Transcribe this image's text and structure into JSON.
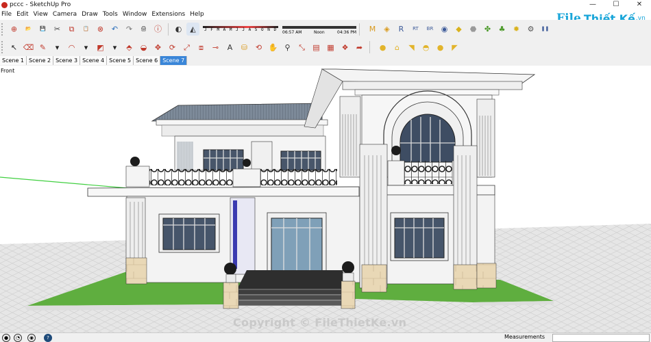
{
  "window": {
    "title": "pccc - SketchUp Pro",
    "min": "—",
    "max": "☐",
    "close": "✕"
  },
  "menu": [
    "File",
    "Edit",
    "View",
    "Camera",
    "Draw",
    "Tools",
    "Window",
    "Extensions",
    "Help"
  ],
  "toolbar_top": [
    {
      "name": "get-started-icon",
      "glyph": "⊕",
      "color": "#c0392b"
    },
    {
      "name": "open-icon",
      "glyph": "📂",
      "color": "#d59b2b"
    },
    {
      "name": "save-icon",
      "glyph": "💾",
      "color": "#3465a4"
    },
    {
      "name": "cut-icon",
      "glyph": "✂",
      "color": "#444"
    },
    {
      "name": "copy-icon",
      "glyph": "⧉",
      "color": "#c0392b"
    },
    {
      "name": "paste-icon",
      "glyph": "📋",
      "color": "#666"
    },
    {
      "name": "erase-icon",
      "glyph": "⊗",
      "color": "#c0392b"
    },
    {
      "name": "undo-icon",
      "glyph": "↶",
      "color": "#2a6ebb"
    },
    {
      "name": "redo-icon",
      "glyph": "↷",
      "color": "#777"
    },
    {
      "name": "print-icon",
      "glyph": "🖨",
      "color": "#333"
    },
    {
      "name": "model-info-icon",
      "glyph": "ⓘ",
      "color": "#c0392b"
    }
  ],
  "shadow": {
    "months": "J F M A M J J A S O N D",
    "time_start": "06:57 AM",
    "time_mid": "Noon",
    "time_end": "04:36 PM"
  },
  "toolbar_top_right": [
    {
      "name": "m-icon",
      "glyph": "M",
      "color": "#d99a1e"
    },
    {
      "name": "tag-icon",
      "glyph": "◈",
      "color": "#d99a1e"
    },
    {
      "name": "r-icon",
      "glyph": "R",
      "color": "#3b5998"
    },
    {
      "name": "rt-icon",
      "glyph": "RT",
      "color": "#3b5998"
    },
    {
      "name": "br-icon",
      "glyph": "BR",
      "color": "#3b5998"
    },
    {
      "name": "orbit-ext-icon",
      "glyph": "◉",
      "color": "#3b5998"
    },
    {
      "name": "tag2-icon",
      "glyph": "◆",
      "color": "#d9b21e"
    },
    {
      "name": "shape-icon",
      "glyph": "⬣",
      "color": "#999"
    },
    {
      "name": "plant-icon",
      "glyph": "✤",
      "color": "#4c9a2a"
    },
    {
      "name": "tree-icon",
      "glyph": "♣",
      "color": "#4c9a2a"
    },
    {
      "name": "gear-icon",
      "glyph": "✹",
      "color": "#d9b21e"
    },
    {
      "name": "settings-icon",
      "glyph": "⚙",
      "color": "#555"
    },
    {
      "name": "pause-icon",
      "glyph": "❚❚",
      "color": "#3b5998"
    }
  ],
  "toolbar_second": [
    {
      "name": "select-icon",
      "glyph": "↖",
      "color": "#222"
    },
    {
      "name": "eraser-icon",
      "glyph": "⌫",
      "color": "#c0392b"
    },
    {
      "name": "pencil-icon",
      "glyph": "✎",
      "color": "#c0392b"
    },
    {
      "name": "dropdown-a-icon",
      "glyph": "▾",
      "color": "#222"
    },
    {
      "name": "arc-icon",
      "glyph": "◠",
      "color": "#c0392b"
    },
    {
      "name": "dropdown-b-icon",
      "glyph": "▾",
      "color": "#222"
    },
    {
      "name": "rectangle-icon",
      "glyph": "◩",
      "color": "#c0392b"
    },
    {
      "name": "dropdown-c-icon",
      "glyph": "▾",
      "color": "#222"
    },
    {
      "name": "push-pull-icon",
      "glyph": "⬘",
      "color": "#c0392b"
    },
    {
      "name": "follow-me-icon",
      "glyph": "◒",
      "color": "#c0392b"
    },
    {
      "name": "move-icon",
      "glyph": "✥",
      "color": "#c0392b"
    },
    {
      "name": "rotate-icon",
      "glyph": "⟳",
      "color": "#c0392b"
    },
    {
      "name": "scale-icon",
      "glyph": "⤢",
      "color": "#c0392b"
    },
    {
      "name": "offset-icon",
      "glyph": "⧈",
      "color": "#c0392b"
    },
    {
      "name": "tape-measure-icon",
      "glyph": "⊸",
      "color": "#c0392b"
    },
    {
      "name": "text-icon",
      "glyph": "A",
      "color": "#333"
    },
    {
      "name": "paint-bucket-icon",
      "glyph": "⛁",
      "color": "#d99a1e"
    },
    {
      "name": "orbit-icon",
      "glyph": "⟲",
      "color": "#c0392b"
    },
    {
      "name": "pan-icon",
      "glyph": "✋",
      "color": "#c0392b"
    },
    {
      "name": "zoom-icon",
      "glyph": "⚲",
      "color": "#333"
    },
    {
      "name": "zoom-extents-icon",
      "glyph": "⤡",
      "color": "#c0392b"
    },
    {
      "name": "warehouse-icon",
      "glyph": "▤",
      "color": "#c0392b"
    },
    {
      "name": "extension-warehouse-icon",
      "glyph": "▦",
      "color": "#c0392b"
    },
    {
      "name": "components-icon",
      "glyph": "❖",
      "color": "#c0392b"
    },
    {
      "name": "share-icon",
      "glyph": "➦",
      "color": "#c0392b"
    }
  ],
  "toolbar_second_right": [
    {
      "name": "sphere-icon",
      "glyph": "●",
      "color": "#e2b42b"
    },
    {
      "name": "lamp-icon",
      "glyph": "⌂",
      "color": "#e2b42b"
    },
    {
      "name": "spot-icon",
      "glyph": "◥",
      "color": "#e2b42b"
    },
    {
      "name": "dome-icon",
      "glyph": "◓",
      "color": "#e2b42b"
    },
    {
      "name": "bulb-icon",
      "glyph": "●",
      "color": "#e2b42b"
    },
    {
      "name": "spot2-icon",
      "glyph": "◤",
      "color": "#e2b42b"
    }
  ],
  "scenes": [
    "Scene 1",
    "Scene 2",
    "Scene 3",
    "Scene 4",
    "Scene 5",
    "Scene 6",
    "Scene 7"
  ],
  "active_scene": "Scene 7",
  "view_label": "Front",
  "status": {
    "measurements_label": "Measurements"
  },
  "watermark": {
    "logo_mark": "File",
    "logo_text": "Thiết Kế",
    "logo_domain": ".vn",
    "copyright": "Copyright © FileThietKe.vn"
  },
  "colors": {
    "active_tab": "#3a86d8",
    "toolbar_bg": "#f0f0f0",
    "accent_blue": "#1aa6d9"
  }
}
